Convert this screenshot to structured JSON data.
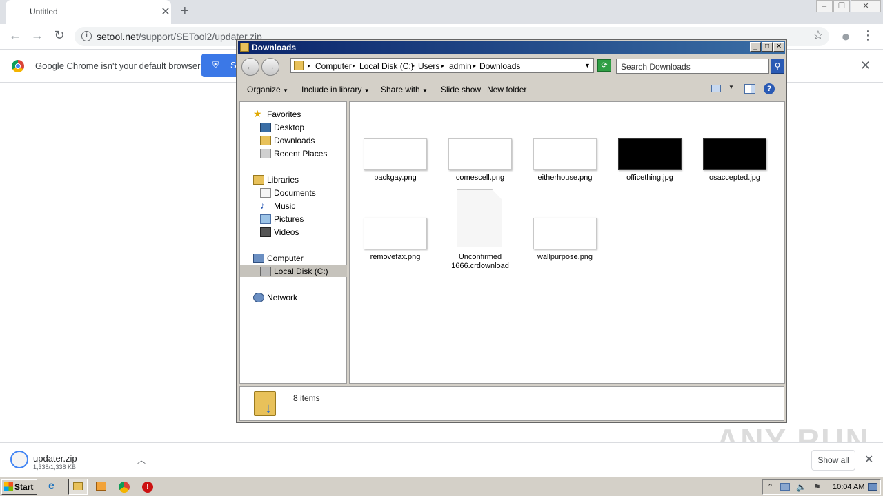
{
  "browser": {
    "tab_title": "Untitled",
    "url_host": "setool.net",
    "url_path": "/support/SETool2/updater.zip",
    "infobar_text": "Google Chrome isn't your default browser",
    "infobar_button_label": "S"
  },
  "explorer": {
    "title": "Downloads",
    "breadcrumbs": [
      "Computer",
      "Local Disk (C:)",
      "Users",
      "admin",
      "Downloads"
    ],
    "search_placeholder": "Search Downloads",
    "commands": [
      "Organize",
      "Include in library",
      "Share with",
      "Slide show",
      "New folder"
    ],
    "nav": {
      "favorites": "Favorites",
      "desktop": "Desktop",
      "downloads": "Downloads",
      "recent": "Recent Places",
      "libraries": "Libraries",
      "documents": "Documents",
      "music": "Music",
      "pictures": "Pictures",
      "videos": "Videos",
      "computer": "Computer",
      "localdisk": "Local Disk (C:)",
      "network": "Network"
    },
    "files": [
      {
        "name": "backgay.png",
        "dark": false
      },
      {
        "name": "comescell.png",
        "dark": false
      },
      {
        "name": "eitherhouse.png",
        "dark": false
      },
      {
        "name": "officething.jpg",
        "dark": true
      },
      {
        "name": "osaccepted.jpg",
        "dark": true
      },
      {
        "name": "removefax.png",
        "dark": false
      },
      {
        "name": "Unconfirmed 1666.crdownload",
        "dark": false
      },
      {
        "name": "wallpurpose.png",
        "dark": false
      }
    ],
    "status": "8 items"
  },
  "shelf": {
    "filename": "updater.zip",
    "size": "1,338/1,338 KB",
    "show_all": "Show all"
  },
  "taskbar": {
    "start": "Start",
    "clock": "10:04 AM"
  },
  "watermark": "ANY RUN"
}
